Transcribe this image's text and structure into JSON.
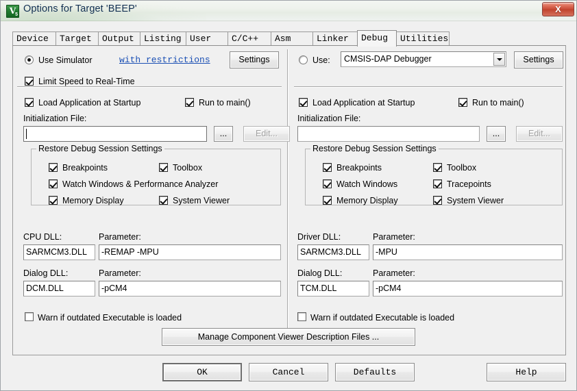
{
  "window": {
    "title": "Options for Target 'BEEP'",
    "icon_glyph": "V",
    "icon_sub": "5",
    "close_label": "X"
  },
  "tabs": [
    {
      "label": "Device",
      "active": false
    },
    {
      "label": "Target",
      "active": false
    },
    {
      "label": "Output",
      "active": false
    },
    {
      "label": "Listing",
      "active": false
    },
    {
      "label": "User",
      "active": false
    },
    {
      "label": "C/C++",
      "active": false
    },
    {
      "label": "Asm",
      "active": false
    },
    {
      "label": "Linker",
      "active": false
    },
    {
      "label": "Debug",
      "active": true
    },
    {
      "label": "Utilities",
      "active": false
    }
  ],
  "left_panel": {
    "use_simulator_label": "Use Simulator",
    "use_simulator_checked": true,
    "restrictions_link": "with restrictions",
    "settings_button": "Settings",
    "limit_speed_label": "Limit Speed to Real-Time",
    "limit_speed_checked": true,
    "load_app_label": "Load Application at Startup",
    "load_app_checked": true,
    "run_to_main_label": "Run to main()",
    "run_to_main_checked": true,
    "init_file_label": "Initialization File:",
    "init_file_value": "",
    "browse_button": "...",
    "edit_button": "Edit...",
    "edit_button_disabled": true,
    "restore_group_title": "Restore Debug Session Settings",
    "restore_items": [
      {
        "label": "Breakpoints",
        "checked": true
      },
      {
        "label": "Toolbox",
        "checked": true
      },
      {
        "label": "Watch Windows & Performance Analyzer",
        "checked": true
      },
      {
        "label": "Memory Display",
        "checked": true
      },
      {
        "label": "System Viewer",
        "checked": true
      }
    ],
    "cpu_dll_label": "CPU DLL:",
    "cpu_dll_value": "SARMCM3.DLL",
    "cpu_param_label": "Parameter:",
    "cpu_param_value": "-REMAP -MPU",
    "dialog_dll_label": "Dialog DLL:",
    "dialog_dll_value": "DCM.DLL",
    "dialog_param_label": "Parameter:",
    "dialog_param_value": "-pCM4",
    "warn_outdated_label": "Warn if outdated Executable is loaded",
    "warn_outdated_checked": false
  },
  "right_panel": {
    "use_label": "Use:",
    "use_checked": false,
    "debugger_selected": "CMSIS-DAP Debugger",
    "settings_button": "Settings",
    "load_app_label": "Load Application at Startup",
    "load_app_checked": true,
    "run_to_main_label": "Run to main()",
    "run_to_main_checked": true,
    "init_file_label": "Initialization File:",
    "init_file_value": "",
    "browse_button": "...",
    "edit_button": "Edit...",
    "edit_button_disabled": true,
    "restore_group_title": "Restore Debug Session Settings",
    "restore_items": [
      {
        "label": "Breakpoints",
        "checked": true
      },
      {
        "label": "Toolbox",
        "checked": true
      },
      {
        "label": "Watch Windows",
        "checked": true
      },
      {
        "label": "Tracepoints",
        "checked": true
      },
      {
        "label": "Memory Display",
        "checked": true
      },
      {
        "label": "System Viewer",
        "checked": true
      }
    ],
    "driver_dll_label": "Driver DLL:",
    "driver_dll_value": "SARMCM3.DLL",
    "driver_param_label": "Parameter:",
    "driver_param_value": "-MPU",
    "dialog_dll_label": "Dialog DLL:",
    "dialog_dll_value": "TCM.DLL",
    "dialog_param_label": "Parameter:",
    "dialog_param_value": "-pCM4",
    "warn_outdated_label": "Warn if outdated Executable is loaded",
    "warn_outdated_checked": false
  },
  "manage_button": "Manage Component Viewer Description Files ...",
  "footer": {
    "ok": "OK",
    "cancel": "Cancel",
    "defaults": "Defaults",
    "help": "Help"
  },
  "colors": {
    "dialog_face": "#f0f0f0",
    "link": "#1a4fb4",
    "title_text": "#123052",
    "close_red": "#ca4c38",
    "icon_green": "#1f7a2f"
  }
}
